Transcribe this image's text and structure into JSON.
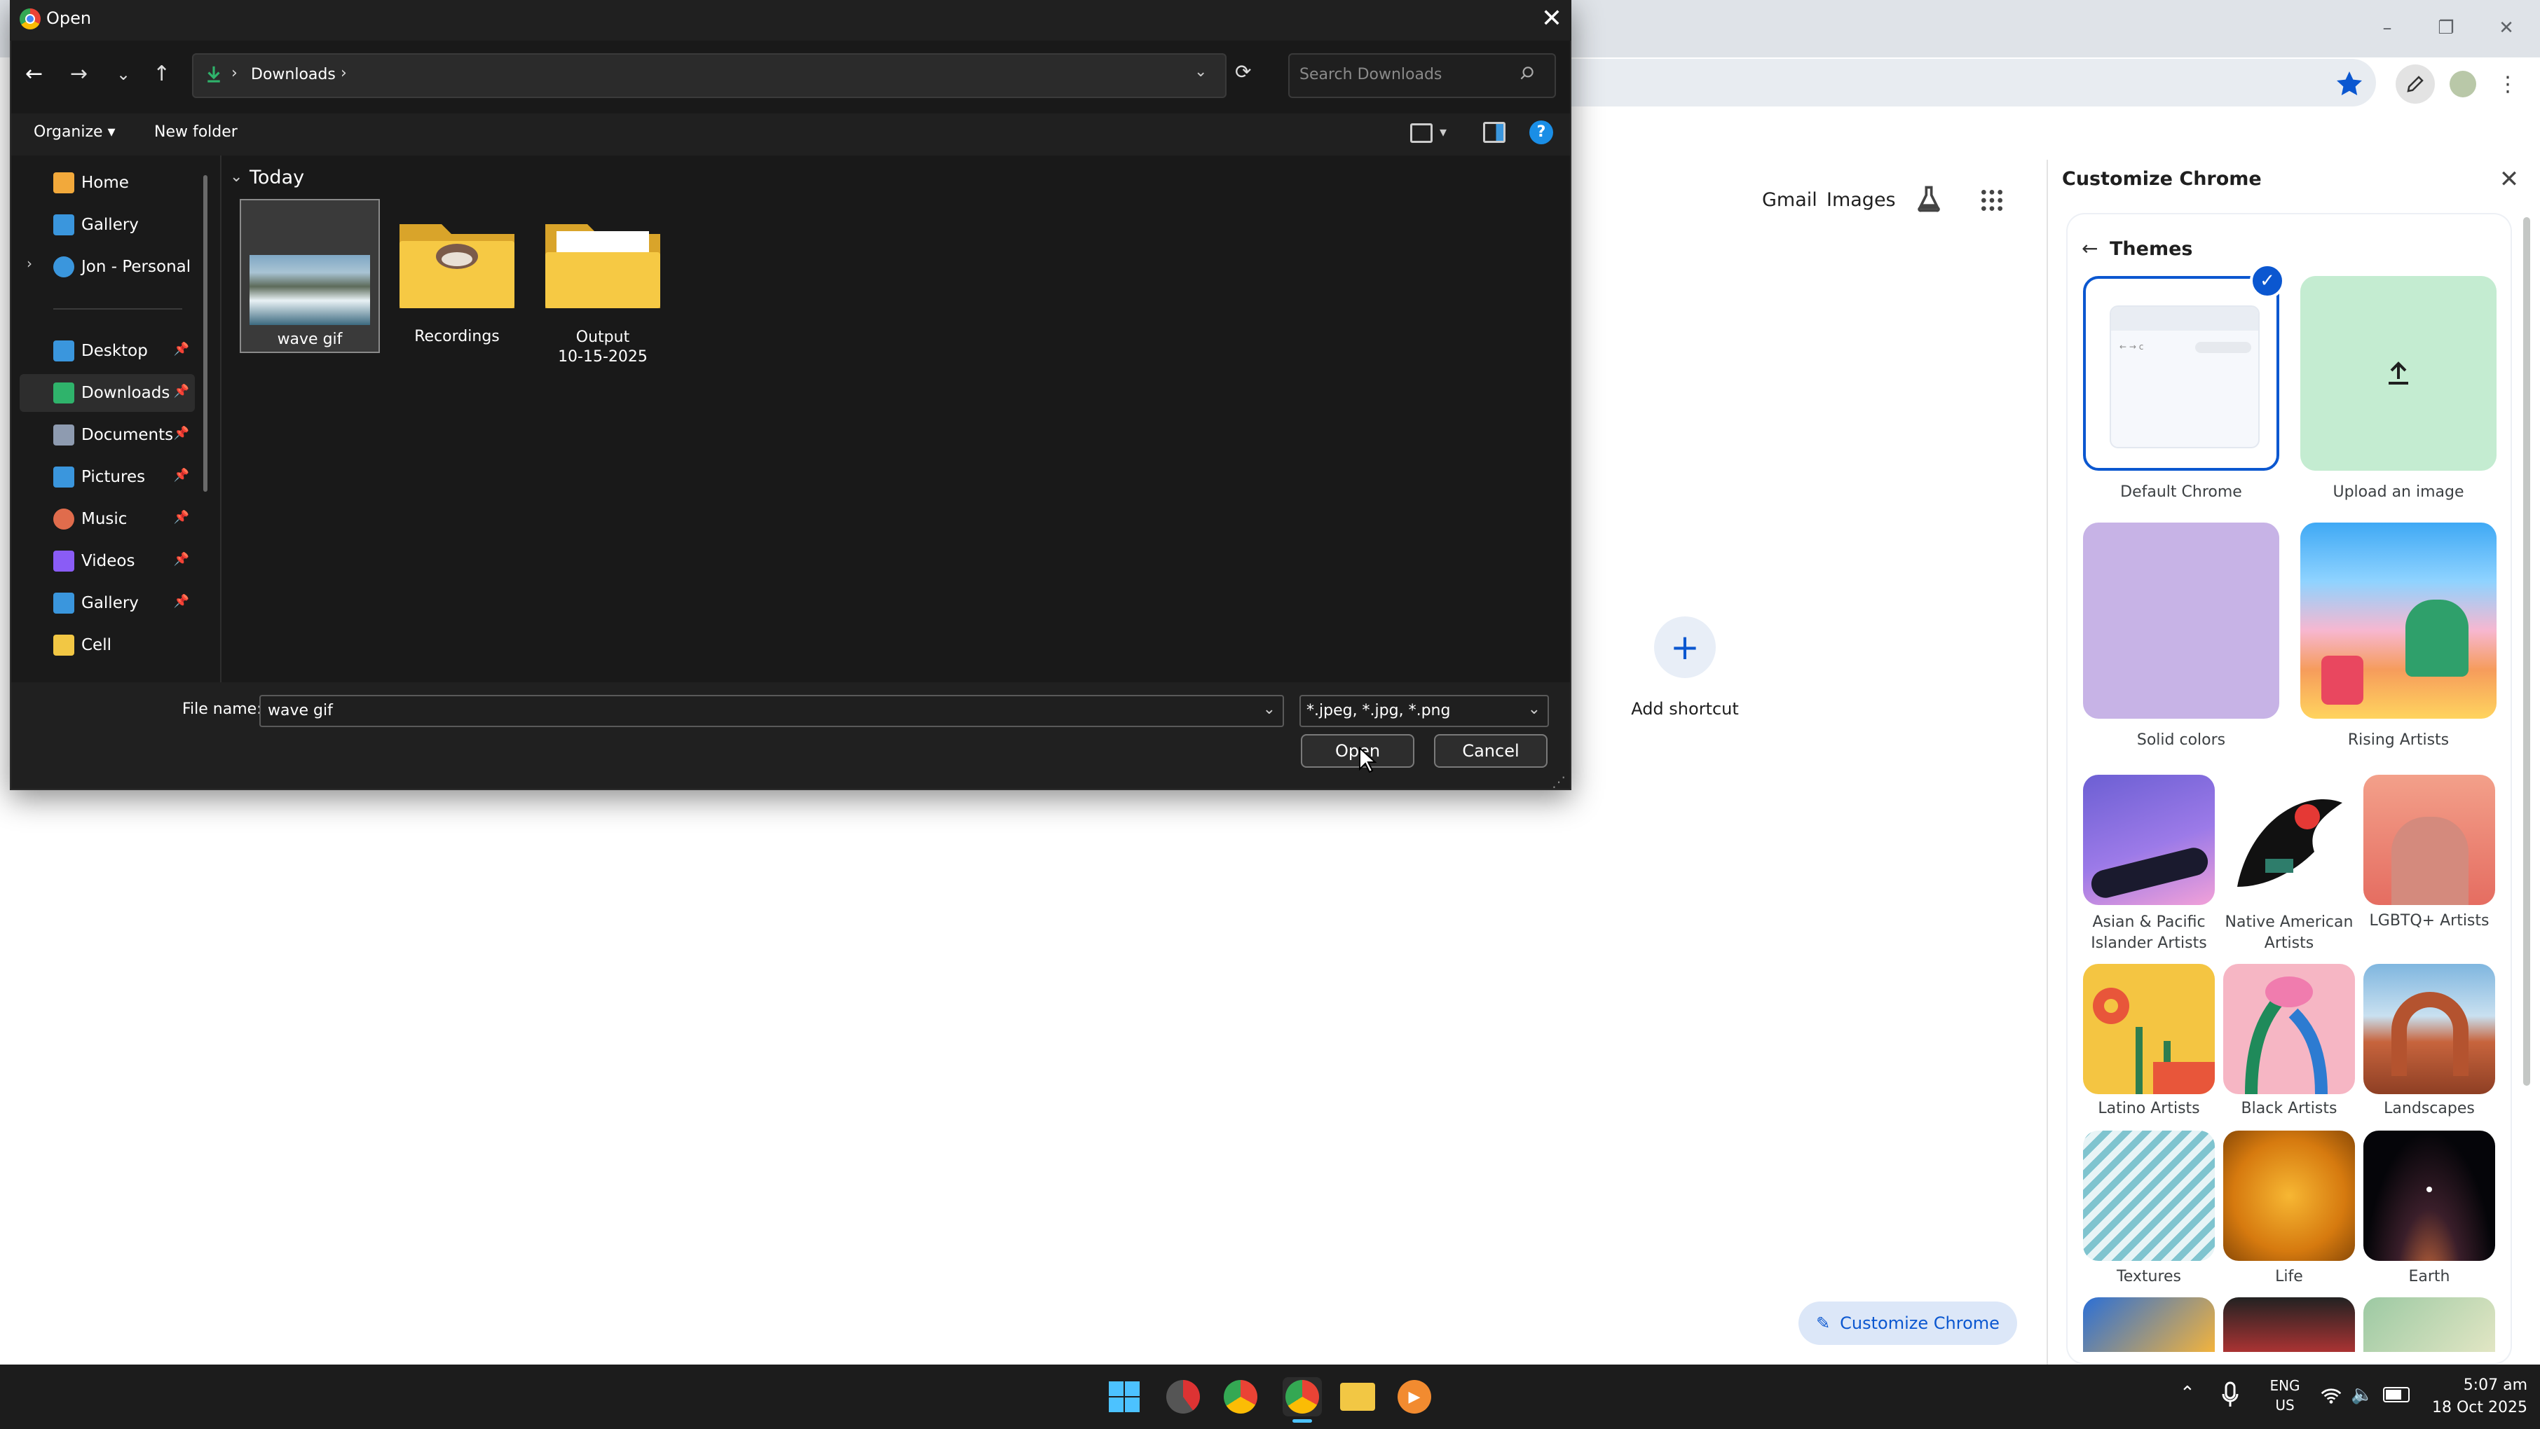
{
  "chrome": {
    "ntp_links": {
      "gmail": "Gmail",
      "images": "Images"
    },
    "add_shortcut_label": "Add shortcut",
    "customize_button_label": "Customize Chrome"
  },
  "side_panel": {
    "title": "Customize Chrome",
    "themes_label": "Themes",
    "themes": [
      {
        "label": "Default Chrome",
        "selected": true
      },
      {
        "label": "Upload an image"
      },
      {
        "label": "Solid colors"
      },
      {
        "label": "Rising Artists"
      },
      {
        "label": "Asian & Pacific Islander Artists",
        "line1": "Asian & Pacific",
        "line2": "Islander Artists"
      },
      {
        "label": "Native American Artists",
        "line1": "Native American",
        "line2": "Artists"
      },
      {
        "label": "LGBTQ+ Artists"
      },
      {
        "label": "Latino Artists"
      },
      {
        "label": "Black Artists"
      },
      {
        "label": "Landscapes"
      },
      {
        "label": "Textures"
      },
      {
        "label": "Life"
      },
      {
        "label": "Earth"
      }
    ]
  },
  "dialog": {
    "title": "Open",
    "breadcrumb": "Downloads",
    "search_placeholder": "Search Downloads",
    "commands": {
      "organize": "Organize",
      "new_folder": "New folder"
    },
    "nav": [
      {
        "label": "Home",
        "icon": "home-icon",
        "color": "#f2a93b"
      },
      {
        "label": "Gallery",
        "icon": "gallery-icon",
        "color": "#3a96dd"
      },
      {
        "label": "Jon - Personal",
        "icon": "cloud-icon",
        "color": "#3a96dd"
      },
      {
        "label": "Desktop",
        "icon": "desktop-icon",
        "color": "#3a96dd",
        "pinned": true
      },
      {
        "label": "Downloads",
        "icon": "download-icon",
        "color": "#2fb36b",
        "pinned": true,
        "selected": true
      },
      {
        "label": "Documents",
        "icon": "documents-icon",
        "color": "#8e9bb0",
        "pinned": true
      },
      {
        "label": "Pictures",
        "icon": "pictures-icon",
        "color": "#3a96dd",
        "pinned": true
      },
      {
        "label": "Music",
        "icon": "music-icon",
        "color": "#e06c4c",
        "pinned": true
      },
      {
        "label": "Videos",
        "icon": "videos-icon",
        "color": "#8a5cf6",
        "pinned": true
      },
      {
        "label": "Gallery",
        "icon": "gallery-icon",
        "color": "#3a96dd",
        "pinned": true
      },
      {
        "label": "Cell",
        "icon": "folder-icon",
        "color": "#f2c744"
      }
    ],
    "group_label": "Today",
    "files": [
      {
        "name": "wave gif",
        "type": "image",
        "selected": true
      },
      {
        "name": "Recordings",
        "type": "folder"
      },
      {
        "name": "Output 10-15-2025",
        "line1": "Output",
        "line2": "10-15-2025",
        "type": "folder"
      }
    ],
    "file_name_label": "File name:",
    "file_name_value": "wave gif",
    "file_type_value": "*.jpeg, *.jpg, *.png",
    "open_label": "Open",
    "cancel_label": "Cancel"
  },
  "taskbar": {
    "lang": "ENG",
    "region": "US",
    "time": "5:07 am",
    "date": "18 Oct 2025"
  },
  "colors": {
    "accent": "#0b57d0",
    "dialog_bg": "#191919",
    "taskbar_bg": "#1c1c1c",
    "folder": "#f2c744"
  }
}
